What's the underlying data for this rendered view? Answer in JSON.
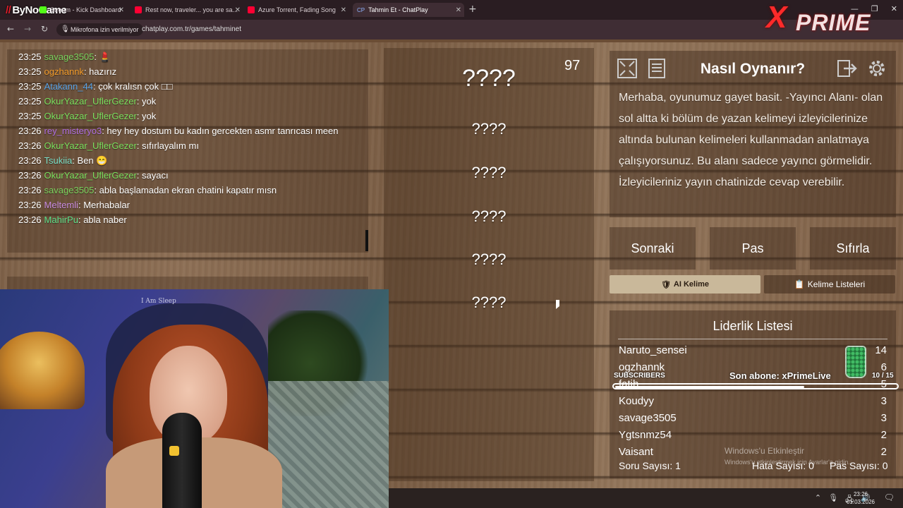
{
  "browser": {
    "logo": "ByNoGame",
    "tabs": [
      {
        "label": "Stream - Kick Dashboard",
        "fav": "#53fc18"
      },
      {
        "label": "Rest now, traveler... you are sa...",
        "fav": "#ff0033"
      },
      {
        "label": "Azure Torrent, Fading Song",
        "fav": "#ff0033"
      },
      {
        "label": "Tahmin Et - ChatPlay",
        "fav": "#4a7bd8",
        "prefix": "CP"
      }
    ],
    "mic_permission": "Mikrofona izin verilmiyor",
    "url": "chatplay.com.tr/games/tahminet",
    "overlay_brand": "PRIME"
  },
  "chat": [
    {
      "time": "23:25",
      "user": "savage3505",
      "color": "#7bd35e",
      "msg": "💄"
    },
    {
      "time": "23:25",
      "user": "ogzhannk",
      "color": "#f39c2a",
      "msg": "hazırız"
    },
    {
      "time": "23:25",
      "user": "Atakann_44",
      "color": "#5aa3e6",
      "msg": "çok kralısn çok □□"
    },
    {
      "time": "23:25",
      "user": "OkurYazar_UflerGezer",
      "color": "#7be05e",
      "msg": "yok"
    },
    {
      "time": "23:25",
      "user": "OkurYazar_UflerGezer",
      "color": "#7be05e",
      "msg": "yok"
    },
    {
      "time": "23:26",
      "user": "rey_misteryo3",
      "color": "#b06fe0",
      "msg": "hey hey dostum bu kadın gercekten asmr tanrıcası meen"
    },
    {
      "time": "23:26",
      "user": "OkurYazar_UflerGezer",
      "color": "#7be05e",
      "msg": "sıfırlayalım mı"
    },
    {
      "time": "23:26",
      "user": "Tsukiia",
      "color": "#7be0c8",
      "msg": "Ben 😁"
    },
    {
      "time": "23:26",
      "user": "OkurYazar_UflerGezer",
      "color": "#7be05e",
      "msg": "sayacı"
    },
    {
      "time": "23:26",
      "user": "savage3505",
      "color": "#7bd35e",
      "msg": "abla başlamadan ekran chatini kapatır mısn"
    },
    {
      "time": "23:26",
      "user": "Meltemli",
      "color": "#c98de0",
      "msg": "Merhabalar"
    },
    {
      "time": "23:26",
      "user": "MahirPu",
      "color": "#5ee08a",
      "msg": "abla naber"
    }
  ],
  "game": {
    "timer": "97",
    "words": [
      "????",
      "????",
      "????",
      "????",
      "????",
      "????"
    ],
    "howto_title": "Nasıl Oynanır?",
    "howto_text": "Merhaba, oyunumuz gayet basit. -Yayıncı Alanı- olan sol altta ki bölüm de yazan kelimeyi izleyicilerinize altında bulunan kelimeleri kullanmadan anlatmaya çalışıyorsunuz. Bu alanı sadece yayıncı görmelidir. İzleyicileriniz yayın chatinizde cevap verebilir.",
    "buttons": {
      "next": "Sonraki",
      "pass": "Pas",
      "reset": "Sıfırla"
    },
    "ai_word": "AI Kelime",
    "word_lists": "Kelime Listeleri"
  },
  "leaderboard": {
    "title": "Liderlik Listesi",
    "rows": [
      {
        "name": "Naruto_sensei",
        "score": "14"
      },
      {
        "name": "ogzhannk",
        "score": "6"
      },
      {
        "name": "fatih",
        "score": "5"
      },
      {
        "name": "Koudyy",
        "score": "3"
      },
      {
        "name": "savage3505",
        "score": "3"
      },
      {
        "name": "Ygtsnmz54",
        "score": "2"
      },
      {
        "name": "Vaisant",
        "score": "2"
      }
    ],
    "questions": "Soru Sayısı: 1",
    "errors": "Hata Sayısı: 0",
    "passes": "Pas Sayısı: 0"
  },
  "subs_overlay": {
    "label": "SUBSCRIBERS",
    "last_sub": "Son abone: xPrimeLive",
    "count": "10 / 15",
    "progress": 0.667
  },
  "windows": {
    "activate_title": "Windows'u Etkinleştir",
    "activate_sub": "Windows'u etkinleştirmek için Ayarlar'a gidin.",
    "time": "23:26",
    "date": "01.03.2026"
  },
  "webcam": {
    "sign": "I Am Sleep"
  }
}
